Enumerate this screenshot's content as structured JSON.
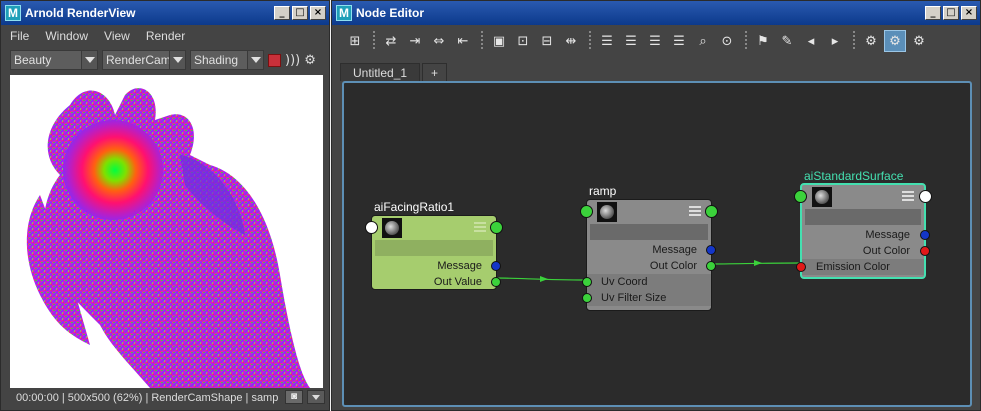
{
  "render_view": {
    "title": "Arnold RenderView",
    "menu": [
      "File",
      "Window",
      "View",
      "Render"
    ],
    "aov_dropdown": "Beauty",
    "camera_dropdown": "RenderCamS",
    "shading_dropdown": "Shading",
    "status_text": "00:00:00 | 500x500 (62%) | RenderCamShape  | samp"
  },
  "node_editor": {
    "title": "Node Editor",
    "tabs": [
      "Untitled_1",
      "+"
    ],
    "nodes": {
      "facing": {
        "name": "aiFacingRatio1",
        "attrs": [
          "Message",
          "Out Value"
        ],
        "color": "#a6cd6e"
      },
      "ramp": {
        "name": "ramp",
        "attrs": [
          "Message",
          "Out Color",
          "Uv Coord",
          "Uv Filter Size"
        ],
        "color": "#8a8a8a"
      },
      "surface": {
        "name": "aiStandardSurface",
        "attrs": [
          "Message",
          "Out Color",
          "Emission Color"
        ],
        "color": "#8a8a8a",
        "highlight": "#44e0b0"
      }
    },
    "connection_color": "#3bd23b"
  },
  "window_buttons": [
    "_",
    "□",
    "×"
  ]
}
